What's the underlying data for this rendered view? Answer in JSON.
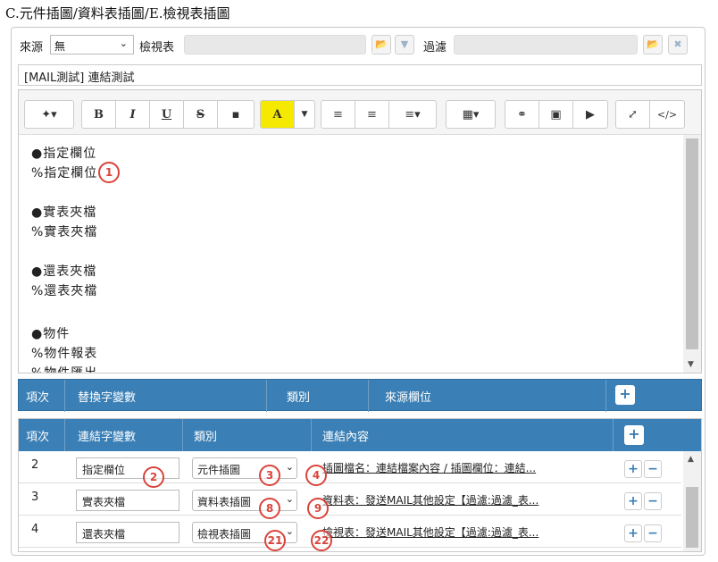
{
  "page_title": "C.元件插圖/資料表插圖/E.檢視表插圖",
  "filter_bar": {
    "source_label": "來源",
    "source_value": "無",
    "view_label": "檢視表",
    "filter_label": "過濾"
  },
  "subject": "[MAIL測試] 連結測試",
  "editor": {
    "lines": [
      "●指定欄位",
      "%指定欄位",
      "",
      "●實表夾檔",
      "%實表夾檔",
      "",
      "●還表夾檔",
      "%還表夾檔",
      "",
      "",
      "●物件",
      "%物件報表",
      "%物件匯出"
    ]
  },
  "grid1": {
    "headers": [
      "項次",
      "替換字變數",
      "類別",
      "來源欄位"
    ],
    "add_label": "+"
  },
  "grid2": {
    "headers": [
      "項次",
      "連結字變數",
      "類別",
      "連結內容"
    ],
    "add_label": "+",
    "rows": [
      {
        "no": "2",
        "var": "指定欄位",
        "type": "元件插圖",
        "content": "插圖檔名：連結檔案內容 / 插圖欄位：連結..."
      },
      {
        "no": "3",
        "var": "實表夾檔",
        "type": "資料表插圖",
        "content": "資料表：發送MAIL其他設定【過濾:過濾_表..."
      },
      {
        "no": "4",
        "var": "還表夾檔",
        "type": "檢視表插圖",
        "content": "檢視表：發送MAIL其他設定【過濾:過濾_表..."
      }
    ]
  },
  "markers": [
    "1",
    "2",
    "3",
    "4",
    "8",
    "9",
    "21",
    "22"
  ],
  "colors": {
    "header_blue": "#3a7fb5",
    "marker_red": "#d9433b"
  }
}
